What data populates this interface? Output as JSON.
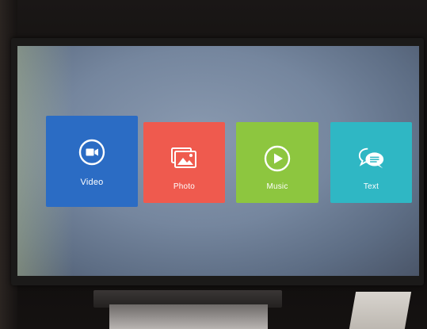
{
  "menu": {
    "tiles": [
      {
        "label": "Video",
        "icon": "video-camera-icon",
        "color": "#2b6cc4"
      },
      {
        "label": "Photo",
        "icon": "photo-icon",
        "color": "#ef5a4e"
      },
      {
        "label": "Music",
        "icon": "play-icon",
        "color": "#8dc63f"
      },
      {
        "label": "Text",
        "icon": "chat-bubbles-icon",
        "color": "#2fb7c4"
      }
    ],
    "selected": "Video"
  }
}
